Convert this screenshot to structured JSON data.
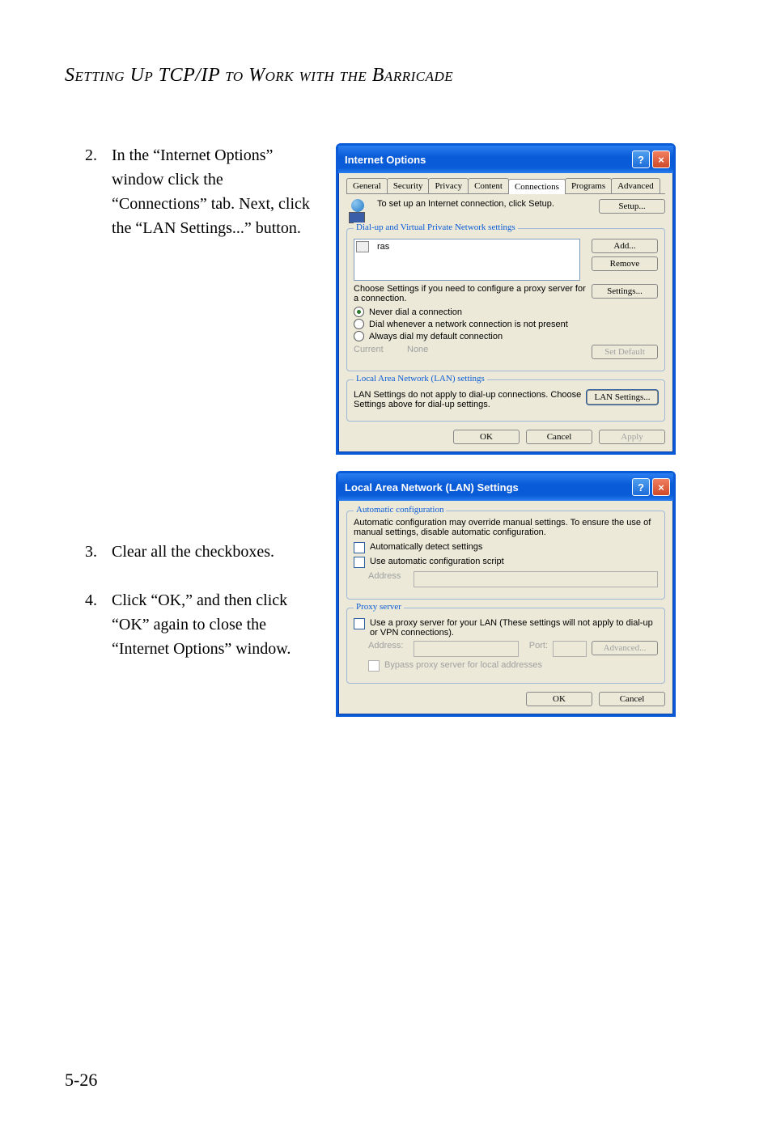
{
  "page": {
    "heading": "Setting Up TCP/IP to Work with the Barricade",
    "page_number": "5-26",
    "steps": [
      {
        "n": "2.",
        "text": "In the “Internet Options” window click the “Connections” tab. Next, click the “LAN Settings...” button."
      },
      {
        "n": "3.",
        "text": "Clear all the checkboxes."
      },
      {
        "n": "4.",
        "text": "Click “OK,” and then click “OK” again to close the “Internet Options” window."
      }
    ]
  },
  "io": {
    "title": "Internet Options",
    "tabs": [
      "General",
      "Security",
      "Privacy",
      "Content",
      "Connections",
      "Programs",
      "Advanced"
    ],
    "setup_text": "To set up an Internet connection, click Setup.",
    "setup_btn": "Setup...",
    "dial_group": "Dial-up and Virtual Private Network settings",
    "list_item": "ras",
    "add_btn": "Add...",
    "remove_btn": "Remove",
    "settings_hint": "Choose Settings if you need to configure a proxy server for a connection.",
    "settings_btn": "Settings...",
    "radios": {
      "never": "Never dial a connection",
      "whenever": "Dial whenever a network connection is not present",
      "always": "Always dial my default connection"
    },
    "current_label": "Current",
    "current_value": "None",
    "set_default_btn": "Set Default",
    "lan_group": "Local Area Network (LAN) settings",
    "lan_text": "LAN Settings do not apply to dial-up connections. Choose Settings above for dial-up settings.",
    "lan_btn": "LAN Settings...",
    "ok": "OK",
    "cancel": "Cancel",
    "apply": "Apply"
  },
  "lan": {
    "title": "Local Area Network (LAN) Settings",
    "auto_group": "Automatic configuration",
    "auto_text": "Automatic configuration may override manual settings.  To ensure the use of manual settings, disable automatic configuration.",
    "auto_detect": "Automatically detect settings",
    "auto_script": "Use automatic configuration script",
    "address_label": "Address",
    "proxy_group": "Proxy server",
    "proxy_use": "Use a proxy server for your LAN (These settings will not apply to dial-up or VPN connections).",
    "addr_label": "Address:",
    "port_label": "Port:",
    "advanced_btn": "Advanced...",
    "bypass": "Bypass proxy server for local addresses",
    "ok": "OK",
    "cancel": "Cancel"
  }
}
